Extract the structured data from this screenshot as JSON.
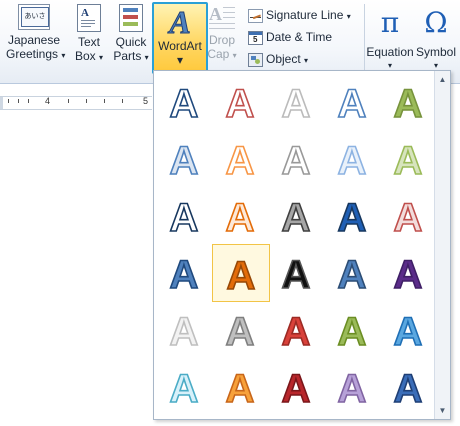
{
  "ribbon": {
    "japanese_greetings": {
      "line1": "Japanese",
      "line2": "Greetings",
      "arrow": "▾",
      "icon": "japanese-greetings-icon",
      "glyph": "あいさつ"
    },
    "text_box": {
      "line1": "Text",
      "line2": "Box",
      "arrow": "▾",
      "icon": "text-box-icon"
    },
    "quick_parts": {
      "line1": "Quick",
      "line2": "Parts",
      "arrow": "▾",
      "icon": "quick-parts-icon"
    },
    "wordart": {
      "label": "WordArt",
      "arrow": "▾",
      "icon": "wordart-icon"
    },
    "drop_cap": {
      "line1": "Drop",
      "line2": "Cap",
      "arrow": "▾",
      "icon": "drop-cap-icon",
      "disabled": true
    },
    "signature_line": {
      "label": "Signature Line",
      "arrow": "▾",
      "icon": "signature-line-icon"
    },
    "date_time": {
      "label": "Date & Time",
      "icon": "calendar-icon"
    },
    "object": {
      "label": "Object",
      "arrow": "▾",
      "icon": "object-icon"
    },
    "equation": {
      "label": "Equation",
      "arrow": "▾",
      "icon": "pi-icon",
      "glyph": "π"
    },
    "symbol": {
      "label": "Symbol",
      "arrow": "▾",
      "icon": "omega-icon",
      "glyph": "Ω"
    }
  },
  "ruler": {
    "marks": [
      "4",
      "5"
    ]
  },
  "gallery": {
    "scroll_up": "▲",
    "scroll_down": "▼",
    "glyph": "A",
    "selected_index": 16,
    "styles": [
      {
        "fill": "#ffffff",
        "stroke": "#1f497d"
      },
      {
        "fill": "#ffffff",
        "stroke": "#c0504d"
      },
      {
        "fill": "#ffffff",
        "stroke": "#bbbbbb"
      },
      {
        "fill": "#ffffff",
        "stroke": "#4f81bd"
      },
      {
        "fill": "#9bbb59",
        "stroke": "#77933c"
      },
      {
        "fill": "#dbe5f1",
        "stroke": "#4f81bd"
      },
      {
        "fill": "#ffffff",
        "stroke": "#f79646"
      },
      {
        "fill": "#ffffff",
        "stroke": "#999999"
      },
      {
        "fill": "#e9f1fa",
        "stroke": "#8db3e2"
      },
      {
        "fill": "#d7e4bd",
        "stroke": "#9bbb59"
      },
      {
        "fill": "#ffffff",
        "stroke": "#17375e"
      },
      {
        "fill": "#fde9d9",
        "stroke": "#e36c09"
      },
      {
        "fill": "#a6a6a6",
        "stroke": "#404040"
      },
      {
        "fill": "#1f5fb5",
        "stroke": "#17375e"
      },
      {
        "fill": "#f2dcdb",
        "stroke": "#c0504d"
      },
      {
        "fill": "#4f81bd",
        "stroke": "#1f497d"
      },
      {
        "fill": "#e36c09",
        "stroke": "#974806"
      },
      {
        "fill": "#111111",
        "stroke": "#555555"
      },
      {
        "fill": "#4f81bd",
        "stroke": "#2c4d75"
      },
      {
        "fill": "#5b2c8a",
        "stroke": "#3f1f66"
      },
      {
        "fill": "#f2f2f2",
        "stroke": "#bfbfbf"
      },
      {
        "fill": "#bfbfbf",
        "stroke": "#7f7f7f"
      },
      {
        "fill": "#d9413a",
        "stroke": "#9c2a24"
      },
      {
        "fill": "#9bbb59",
        "stroke": "#6b8e23"
      },
      {
        "fill": "#5aa7e0",
        "stroke": "#1f6fb5"
      },
      {
        "fill": "#d8f1fa",
        "stroke": "#4bacc6"
      },
      {
        "fill": "#f7a13a",
        "stroke": "#c8661a"
      },
      {
        "fill": "#b8262b",
        "stroke": "#7a161a"
      },
      {
        "fill": "#b7a1d8",
        "stroke": "#8064a2"
      },
      {
        "fill": "#3a6db8",
        "stroke": "#1f3f75"
      }
    ]
  }
}
